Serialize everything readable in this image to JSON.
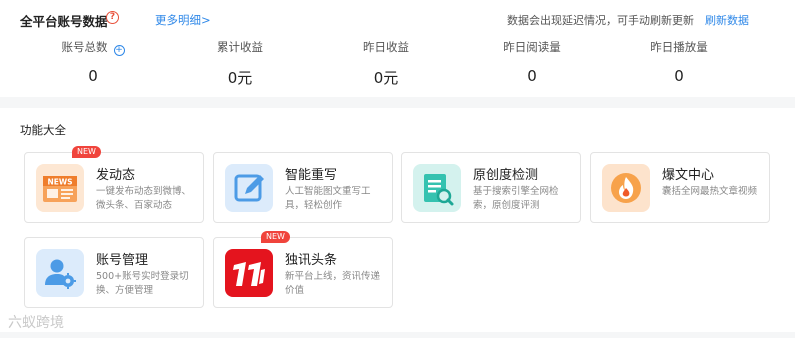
{
  "stats": {
    "title": "全平台账号数据",
    "help_icon": "?",
    "more_link": "更多明细>",
    "delay_note": "数据会出现延迟情况，可手动刷新更新",
    "refresh_link": "刷新数据",
    "items": [
      {
        "label": "账号总数",
        "value": "0"
      },
      {
        "label": "累计收益",
        "value": "0元"
      },
      {
        "label": "昨日收益",
        "value": "0元"
      },
      {
        "label": "昨日阅读量",
        "value": "0"
      },
      {
        "label": "昨日播放量",
        "value": "0"
      }
    ],
    "add_icon": "+"
  },
  "features": {
    "title": "功能大全",
    "tiles": [
      {
        "name": "发动态",
        "desc": "一键发布动态到微博、微头条、百家动态",
        "badge": "NEW",
        "icon": "news-icon",
        "icon_label": "NEWS"
      },
      {
        "name": "智能重写",
        "desc": "人工智能图文重写工具，轻松创作",
        "icon": "edit-icon"
      },
      {
        "name": "原创度检测",
        "desc": "基于搜索引擎全网检索，原创度评测",
        "icon": "document-search-icon"
      },
      {
        "name": "爆文中心",
        "desc": "囊括全网最热文章视频",
        "icon": "flame-icon"
      },
      {
        "name": "账号管理",
        "desc": "500+账号实时登录切换、方便管理",
        "icon": "user-settings-icon"
      },
      {
        "name": "独讯头条",
        "desc": "新平台上线，资讯传递价值",
        "badge": "NEW",
        "icon": "dxtt-logo-icon"
      }
    ]
  },
  "watermark": "六蚁跨境"
}
